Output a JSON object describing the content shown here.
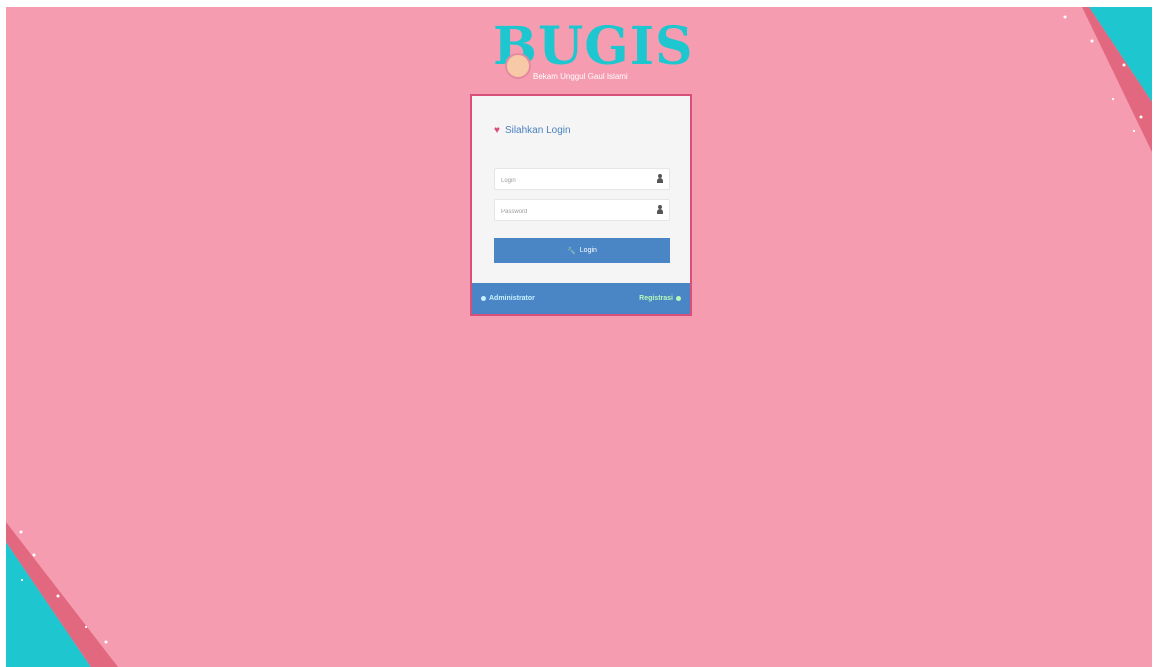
{
  "branding": {
    "logo_text": "BUGIS",
    "tagline": "Bekam Unggul Gaul Islami",
    "accent_color": "#1ec7cf",
    "background_color": "#f69cb0"
  },
  "login_card": {
    "title": "Silahkan Login",
    "heart_icon": "♥",
    "username_placeholder": "Login",
    "password_placeholder": "Password",
    "login_button_label": "Login",
    "key_icon": "🔧"
  },
  "footer": {
    "administrator_label": "Administrator",
    "register_label": "Registrasi"
  }
}
